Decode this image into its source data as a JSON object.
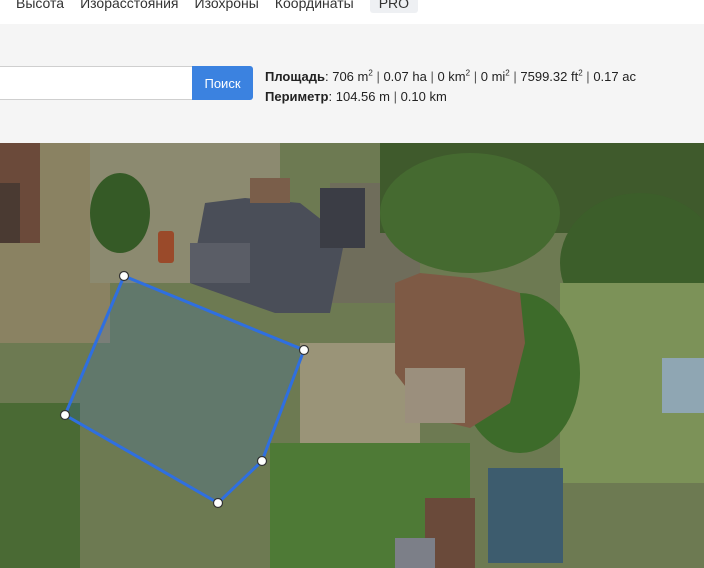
{
  "nav": {
    "items": [
      "Высота",
      "Изорасстояния",
      "Изохроны",
      "Координаты"
    ],
    "pro_label": "PRO"
  },
  "search": {
    "value": "",
    "placeholder": "",
    "button_label": "Поиск"
  },
  "measurement": {
    "area_label": "Площадь",
    "area_m2": "706 m",
    "area_ha": "0.07 ha",
    "area_km2": "0 km",
    "area_mi2": "0 mi",
    "area_ft2": "7599.32 ft",
    "area_ac": "0.17 ac",
    "perimeter_label": "Периметр",
    "perimeter_m": "104.56 m",
    "perimeter_km": "0.10 km",
    "sq": "2"
  },
  "colors": {
    "button": "#3b82e0",
    "polygon_stroke": "#2f6fe0",
    "toolbar_bg": "#f5f5f5"
  },
  "icons": [
    "polygon-vertex-handle"
  ]
}
